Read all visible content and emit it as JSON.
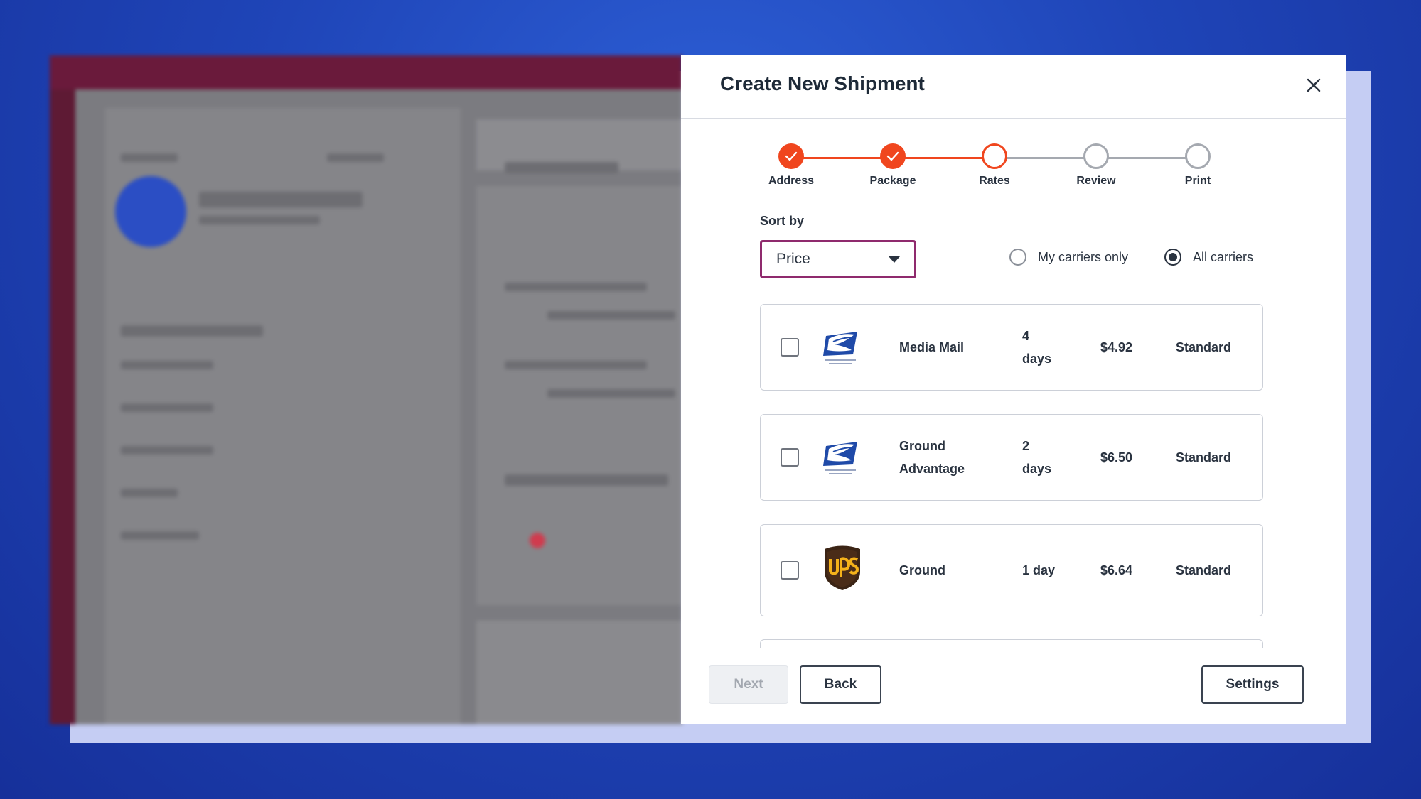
{
  "modal": {
    "title": "Create New Shipment",
    "close_icon": "close-icon"
  },
  "colors": {
    "accent": "#f0461e",
    "select_border": "#8f2a6d",
    "text": "#2a3340",
    "background_blue": "#1f45b8"
  },
  "stepper": {
    "steps": [
      {
        "label": "Address",
        "state": "done"
      },
      {
        "label": "Package",
        "state": "done"
      },
      {
        "label": "Rates",
        "state": "current"
      },
      {
        "label": "Review",
        "state": "todo"
      },
      {
        "label": "Print",
        "state": "todo"
      }
    ]
  },
  "sort": {
    "label": "Sort by",
    "selected": "Price"
  },
  "carrier_filter": {
    "options": [
      {
        "label": "My carriers only",
        "checked": false
      },
      {
        "label": "All carriers",
        "checked": true
      }
    ]
  },
  "rates": [
    {
      "carrier_icon": "usps-eagle-icon",
      "service": [
        "Media Mail"
      ],
      "days": [
        "4",
        "days"
      ],
      "price": "$4.92",
      "tier": "Standard",
      "checked": false
    },
    {
      "carrier_icon": "usps-eagle-icon",
      "service": [
        "Ground",
        "Advantage"
      ],
      "days": [
        "2",
        "days"
      ],
      "price": "$6.50",
      "tier": "Standard",
      "checked": false
    },
    {
      "carrier_icon": "ups-shield-icon",
      "service": [
        "Ground"
      ],
      "days": [
        "1 day"
      ],
      "price": "$6.64",
      "tier": "Standard",
      "checked": false
    }
  ],
  "footer": {
    "next_label": "Next",
    "back_label": "Back",
    "settings_label": "Settings"
  }
}
